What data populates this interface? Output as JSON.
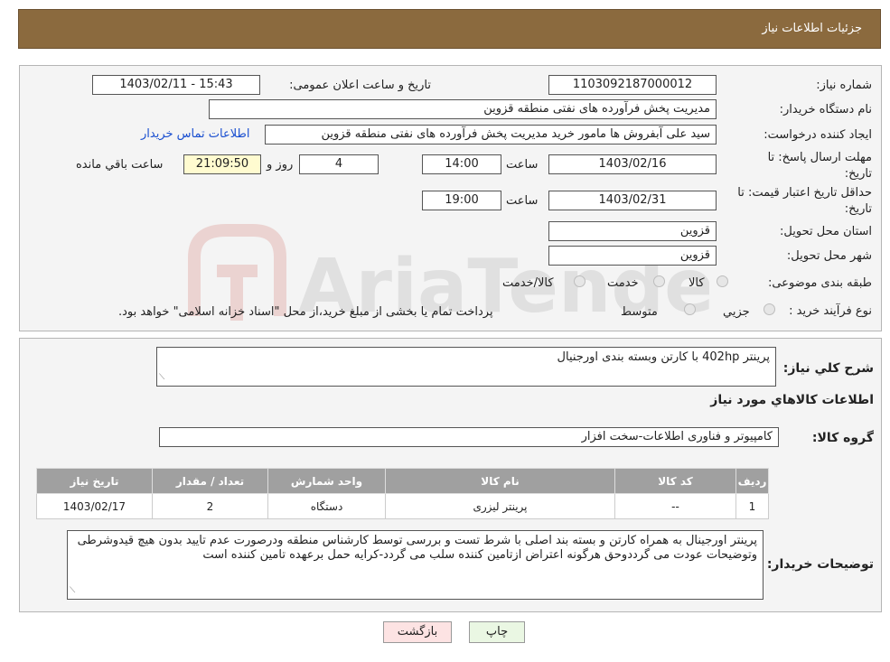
{
  "header": {
    "title": "جزئیات اطلاعات نیاز"
  },
  "fields": {
    "need_number_label": "شماره نیاز:",
    "need_number": "1103092187000012",
    "announce_label": "تاریخ و ساعت اعلان عمومی:",
    "announce_value": "1403/02/11 - 15:43",
    "buyer_org_label": "نام دستگاه خریدار:",
    "buyer_org": "مدیریت پخش فرآورده های نفتی منطقه قزوین",
    "creator_label": "ایجاد کننده درخواست:",
    "creator": "سید علی  آبفروش ها مامور خرید مدیریت پخش فرآورده های نفتی منطقه قزوین",
    "contact_link": "اطلاعات تماس خریدار",
    "deadline_label_1": "مهلت ارسال پاسخ: تا",
    "deadline_label_2": "تاریخ:",
    "deadline_date": "1403/02/16",
    "time_label": "ساعت",
    "deadline_time": "14:00",
    "days_value": "4",
    "days_label": "روز و",
    "remaining_time": "21:09:50",
    "remaining_label": "ساعت باقي مانده",
    "validity_label_1": "حداقل تاریخ اعتبار قیمت: تا",
    "validity_label_2": "تاریخ:",
    "validity_date": "1403/02/31",
    "validity_time": "19:00",
    "province_label": "استان محل تحویل:",
    "province": "قزوین",
    "city_label": "شهر محل تحویل:",
    "city": "قزوین",
    "category_label": "طبقه بندی موضوعی:",
    "category_options": [
      "کالا",
      "خدمت",
      "کالا/خدمت"
    ],
    "process_label": "نوع فرآیند خرید :",
    "process_options": [
      "جزیي",
      "متوسط"
    ],
    "process_note": "پرداخت تمام یا بخشی از مبلغ خرید،از محل \"اسناد خزانه اسلامی\" خواهد بود."
  },
  "summary": {
    "label": "شرح كلي نياز:",
    "value": "پرینتر 402hp با کارتن وبسته بندی اورجنیال"
  },
  "goods_section_title": "اطلاعات کالاهاي مورد نياز",
  "goods_group": {
    "label": "گروه کالا:",
    "value": "کامپیوتر و فناوری اطلاعات-سخت افزار"
  },
  "table": {
    "headers": [
      "ردیف",
      "کد کالا",
      "نام کالا",
      "واحد شمارش",
      "تعداد / مقدار",
      "تاریخ نیاز"
    ],
    "rows": [
      [
        "1",
        "--",
        "پرینتر لیزری",
        "دستگاه",
        "2",
        "1403/02/17"
      ]
    ]
  },
  "buyer_notes": {
    "label": "توضیحات خریدار:",
    "value": "پرینتر اورجینال به همراه کارتن و بسته بند اصلی با  شرط تست و بررسی توسط کارشناس منطقه ودرصورت عدم تایید بدون هیچ قیدوشرطی وتوضیحات عودت می گرددوحق هرگونه اعتراض ازتامین کننده سلب می گردد-کرایه حمل برعهده تامین کننده است"
  },
  "buttons": {
    "print": "چاپ",
    "back": "بازگشت"
  },
  "watermark_text": "AriaTender.neT",
  "colors": {
    "header": "#8b6a3e",
    "table_header": "#a0a0a0",
    "back_button": "#fde3e3",
    "print_button": "#eaf7e3"
  }
}
